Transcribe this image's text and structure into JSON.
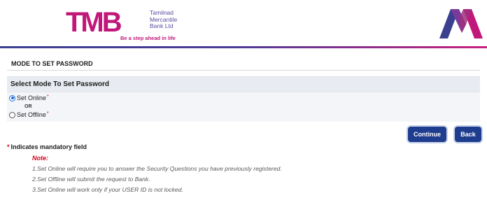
{
  "header": {
    "logo_text": "TMB",
    "bank_name_lines": [
      "Tamilnad",
      "Mercantile",
      "Bank Ltd"
    ],
    "tagline": "Be a step ahead in life",
    "colors": {
      "brand_magenta": "#c2177a",
      "brand_purple": "#5b4aa0",
      "brand_navy": "#3a3f8f"
    }
  },
  "page": {
    "section_title": "MODE TO SET PASSWORD",
    "panel_title": "Select Mode To Set Password"
  },
  "options": [
    {
      "label": "Set Online",
      "required_mark": "*",
      "selected": true
    },
    {
      "label": "Set Offline",
      "required_mark": "*",
      "selected": false
    }
  ],
  "separator": "OR",
  "buttons": {
    "continue": "Continue",
    "back": "Back",
    "color": "#1f3d8f"
  },
  "footer": {
    "mandatory_star": "*",
    "mandatory_text": "Indicates mandatory field",
    "note_label": "Note:",
    "notes": [
      "1.Set Online will require you to answer the Security Questions you have previously registered.",
      "2.Set Offline will submit the request to Bank.",
      "3.Set Online will work only if your USER ID is not locked."
    ]
  }
}
